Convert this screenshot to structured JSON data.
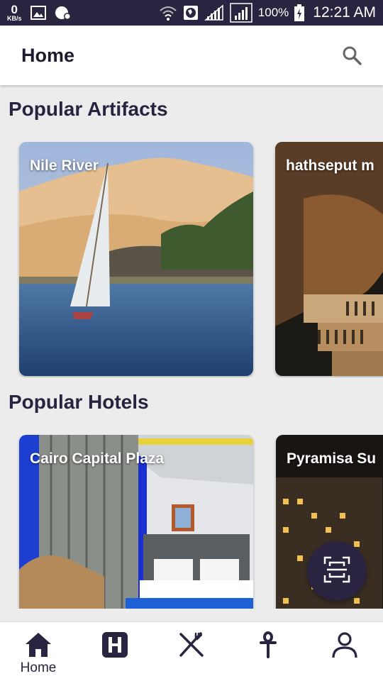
{
  "status_bar": {
    "net_speed_value": "0",
    "net_speed_unit": "KB/s",
    "battery_percent": "100%",
    "time": "12:21 AM"
  },
  "app_bar": {
    "title": "Home",
    "search_icon": "search-icon"
  },
  "sections": [
    {
      "title": "Popular Artifacts",
      "cards": [
        {
          "label": "Nile River"
        },
        {
          "label": "hathseput m"
        }
      ]
    },
    {
      "title": "Popular Hotels",
      "cards": [
        {
          "label": "Cairo Capital Plaza"
        },
        {
          "label": "Pyramisa Su"
        }
      ]
    }
  ],
  "fab": {
    "icon": "qr-scan-icon"
  },
  "bottom_nav": {
    "items": [
      {
        "icon": "home-icon",
        "label": "Home",
        "active": true
      },
      {
        "icon": "hotel-icon",
        "label": ""
      },
      {
        "icon": "restaurant-icon",
        "label": ""
      },
      {
        "icon": "ankh-icon",
        "label": ""
      },
      {
        "icon": "profile-icon",
        "label": ""
      }
    ]
  },
  "colors": {
    "primary_dark": "#2b2440",
    "text_dark": "#2a2340",
    "background": "#ececec"
  }
}
